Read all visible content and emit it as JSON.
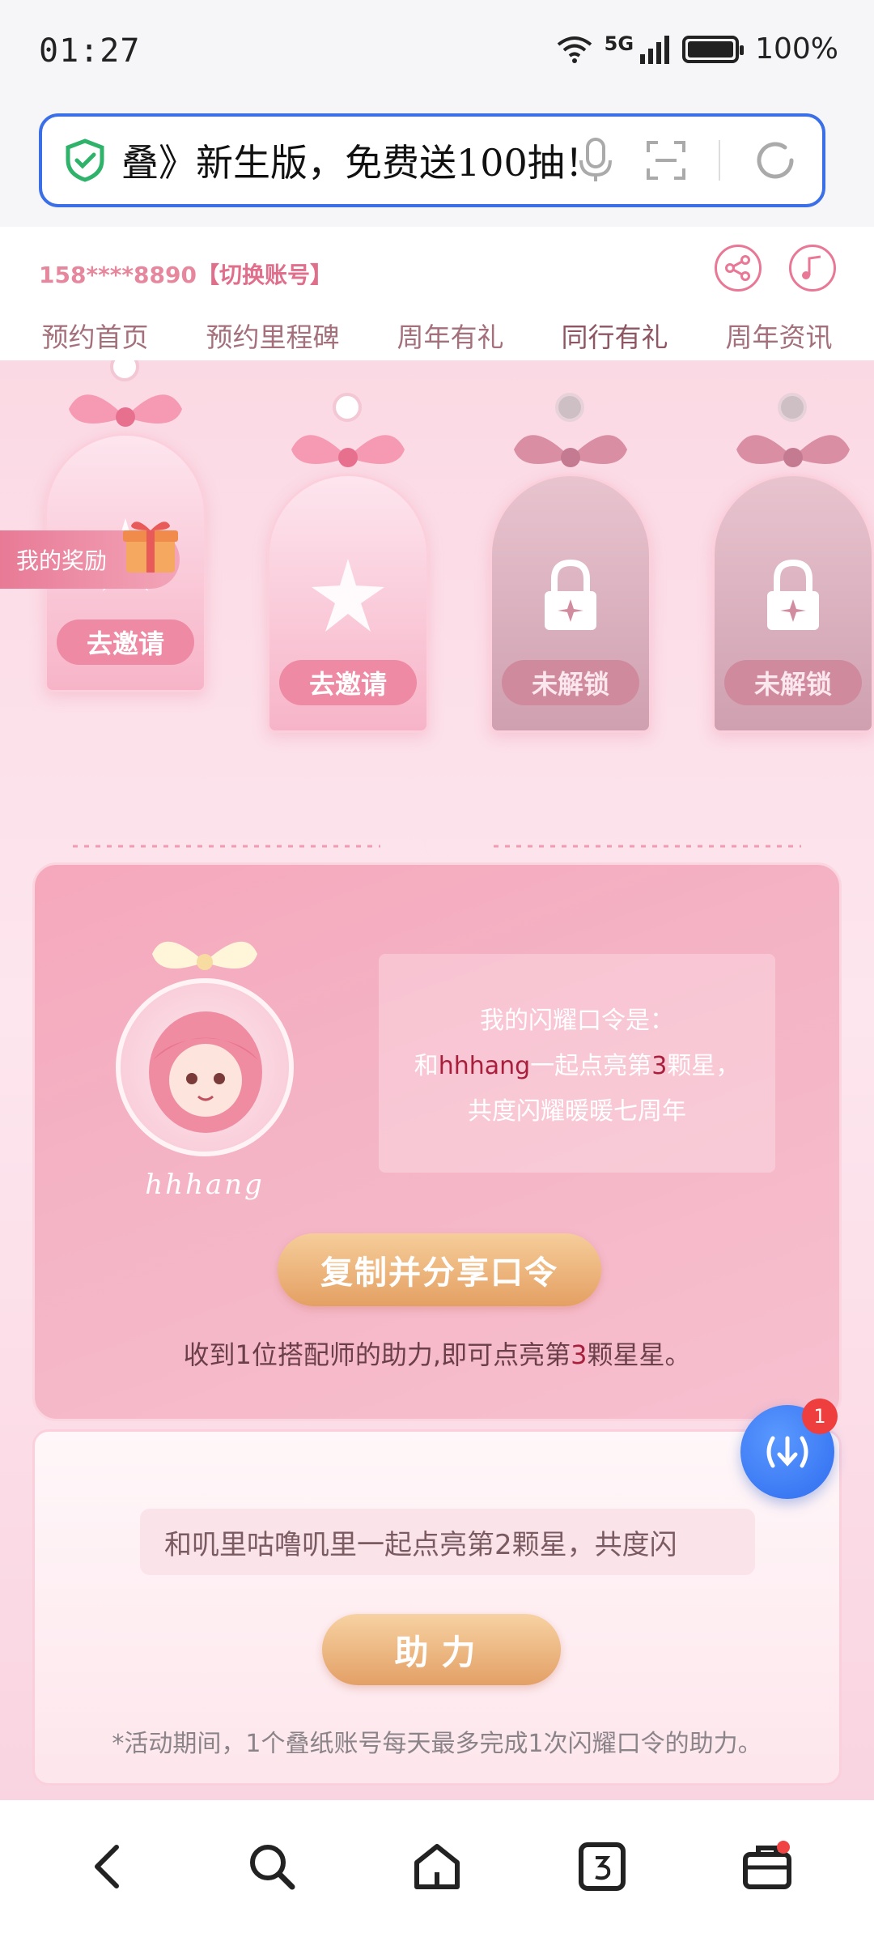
{
  "status_bar": {
    "time": "01:27",
    "network": "5G",
    "battery": "100%"
  },
  "search_bar": {
    "text": "叠》新生版，免费送100抽！"
  },
  "account": {
    "phone": "158****8890",
    "switch_label": "【切换账号】"
  },
  "tabs": [
    {
      "label": "预约首页"
    },
    {
      "label": "预约里程碑"
    },
    {
      "label": "周年有礼"
    },
    {
      "label": "同行有礼",
      "active": true
    },
    {
      "label": "周年资讯"
    }
  ],
  "my_rewards_label": "我的奖励",
  "reward_cards": [
    {
      "button": "去邀请",
      "locked": false
    },
    {
      "button": "去邀请",
      "locked": false
    },
    {
      "button": "未解锁",
      "locked": true
    },
    {
      "button": "未解锁",
      "locked": true
    }
  ],
  "command_panel": {
    "username": "hhhang",
    "line1": "我的闪耀口令是：",
    "line2_prefix": "和",
    "line2_name": "hhhang",
    "line2_mid": "一起点亮第",
    "line2_num": "3",
    "line2_suffix": "颗星，",
    "line3": "共度闪耀暖暖七周年",
    "copy_button": "复制并分享口令",
    "hint_prefix": "收到1位搭配师的助力,即可点亮第",
    "hint_num": "3",
    "hint_suffix": "颗星星。"
  },
  "help_panel": {
    "input_value": "和叽里咕噜叽里一起点亮第2颗星，共度闪",
    "help_button": "助力",
    "note": "*活动期间，1个叠纸账号每天最多完成1次闪耀口令的助力。"
  },
  "fab": {
    "badge": "1"
  },
  "colors": {
    "accent_pink": "#e87a96",
    "gold_button": "#e4a063",
    "fab_blue": "#2f6df0"
  }
}
